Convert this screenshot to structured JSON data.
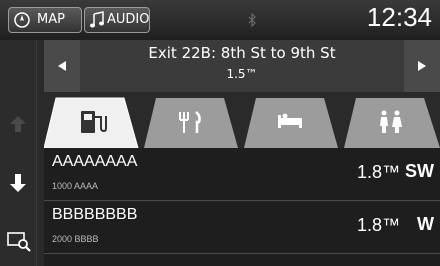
{
  "header": {
    "map_label": "MAP",
    "audio_label": "AUDIO",
    "time": "12:34"
  },
  "exit_info": {
    "title": "Exit 22B: 8th St to 9th St",
    "distance": "1.5™"
  },
  "tabs": [
    {
      "name": "gas",
      "icon": "gas-station-icon",
      "active": true
    },
    {
      "name": "food",
      "icon": "fork-knife-icon",
      "active": false
    },
    {
      "name": "lodging",
      "icon": "bed-icon",
      "active": false
    },
    {
      "name": "restroom",
      "icon": "restroom-icon",
      "active": false
    }
  ],
  "results": [
    {
      "name": "AAAAAAAA",
      "address": "1000 AAAA",
      "distance": "1.8™",
      "direction": "SW"
    },
    {
      "name": "BBBBBBBB",
      "address": "2000 BBBB",
      "distance": "1.8™",
      "direction": "W"
    }
  ],
  "colors": {
    "accent": "#ffffff",
    "tab_active": "#ececec",
    "tab_inactive": "#9a9a9a"
  }
}
